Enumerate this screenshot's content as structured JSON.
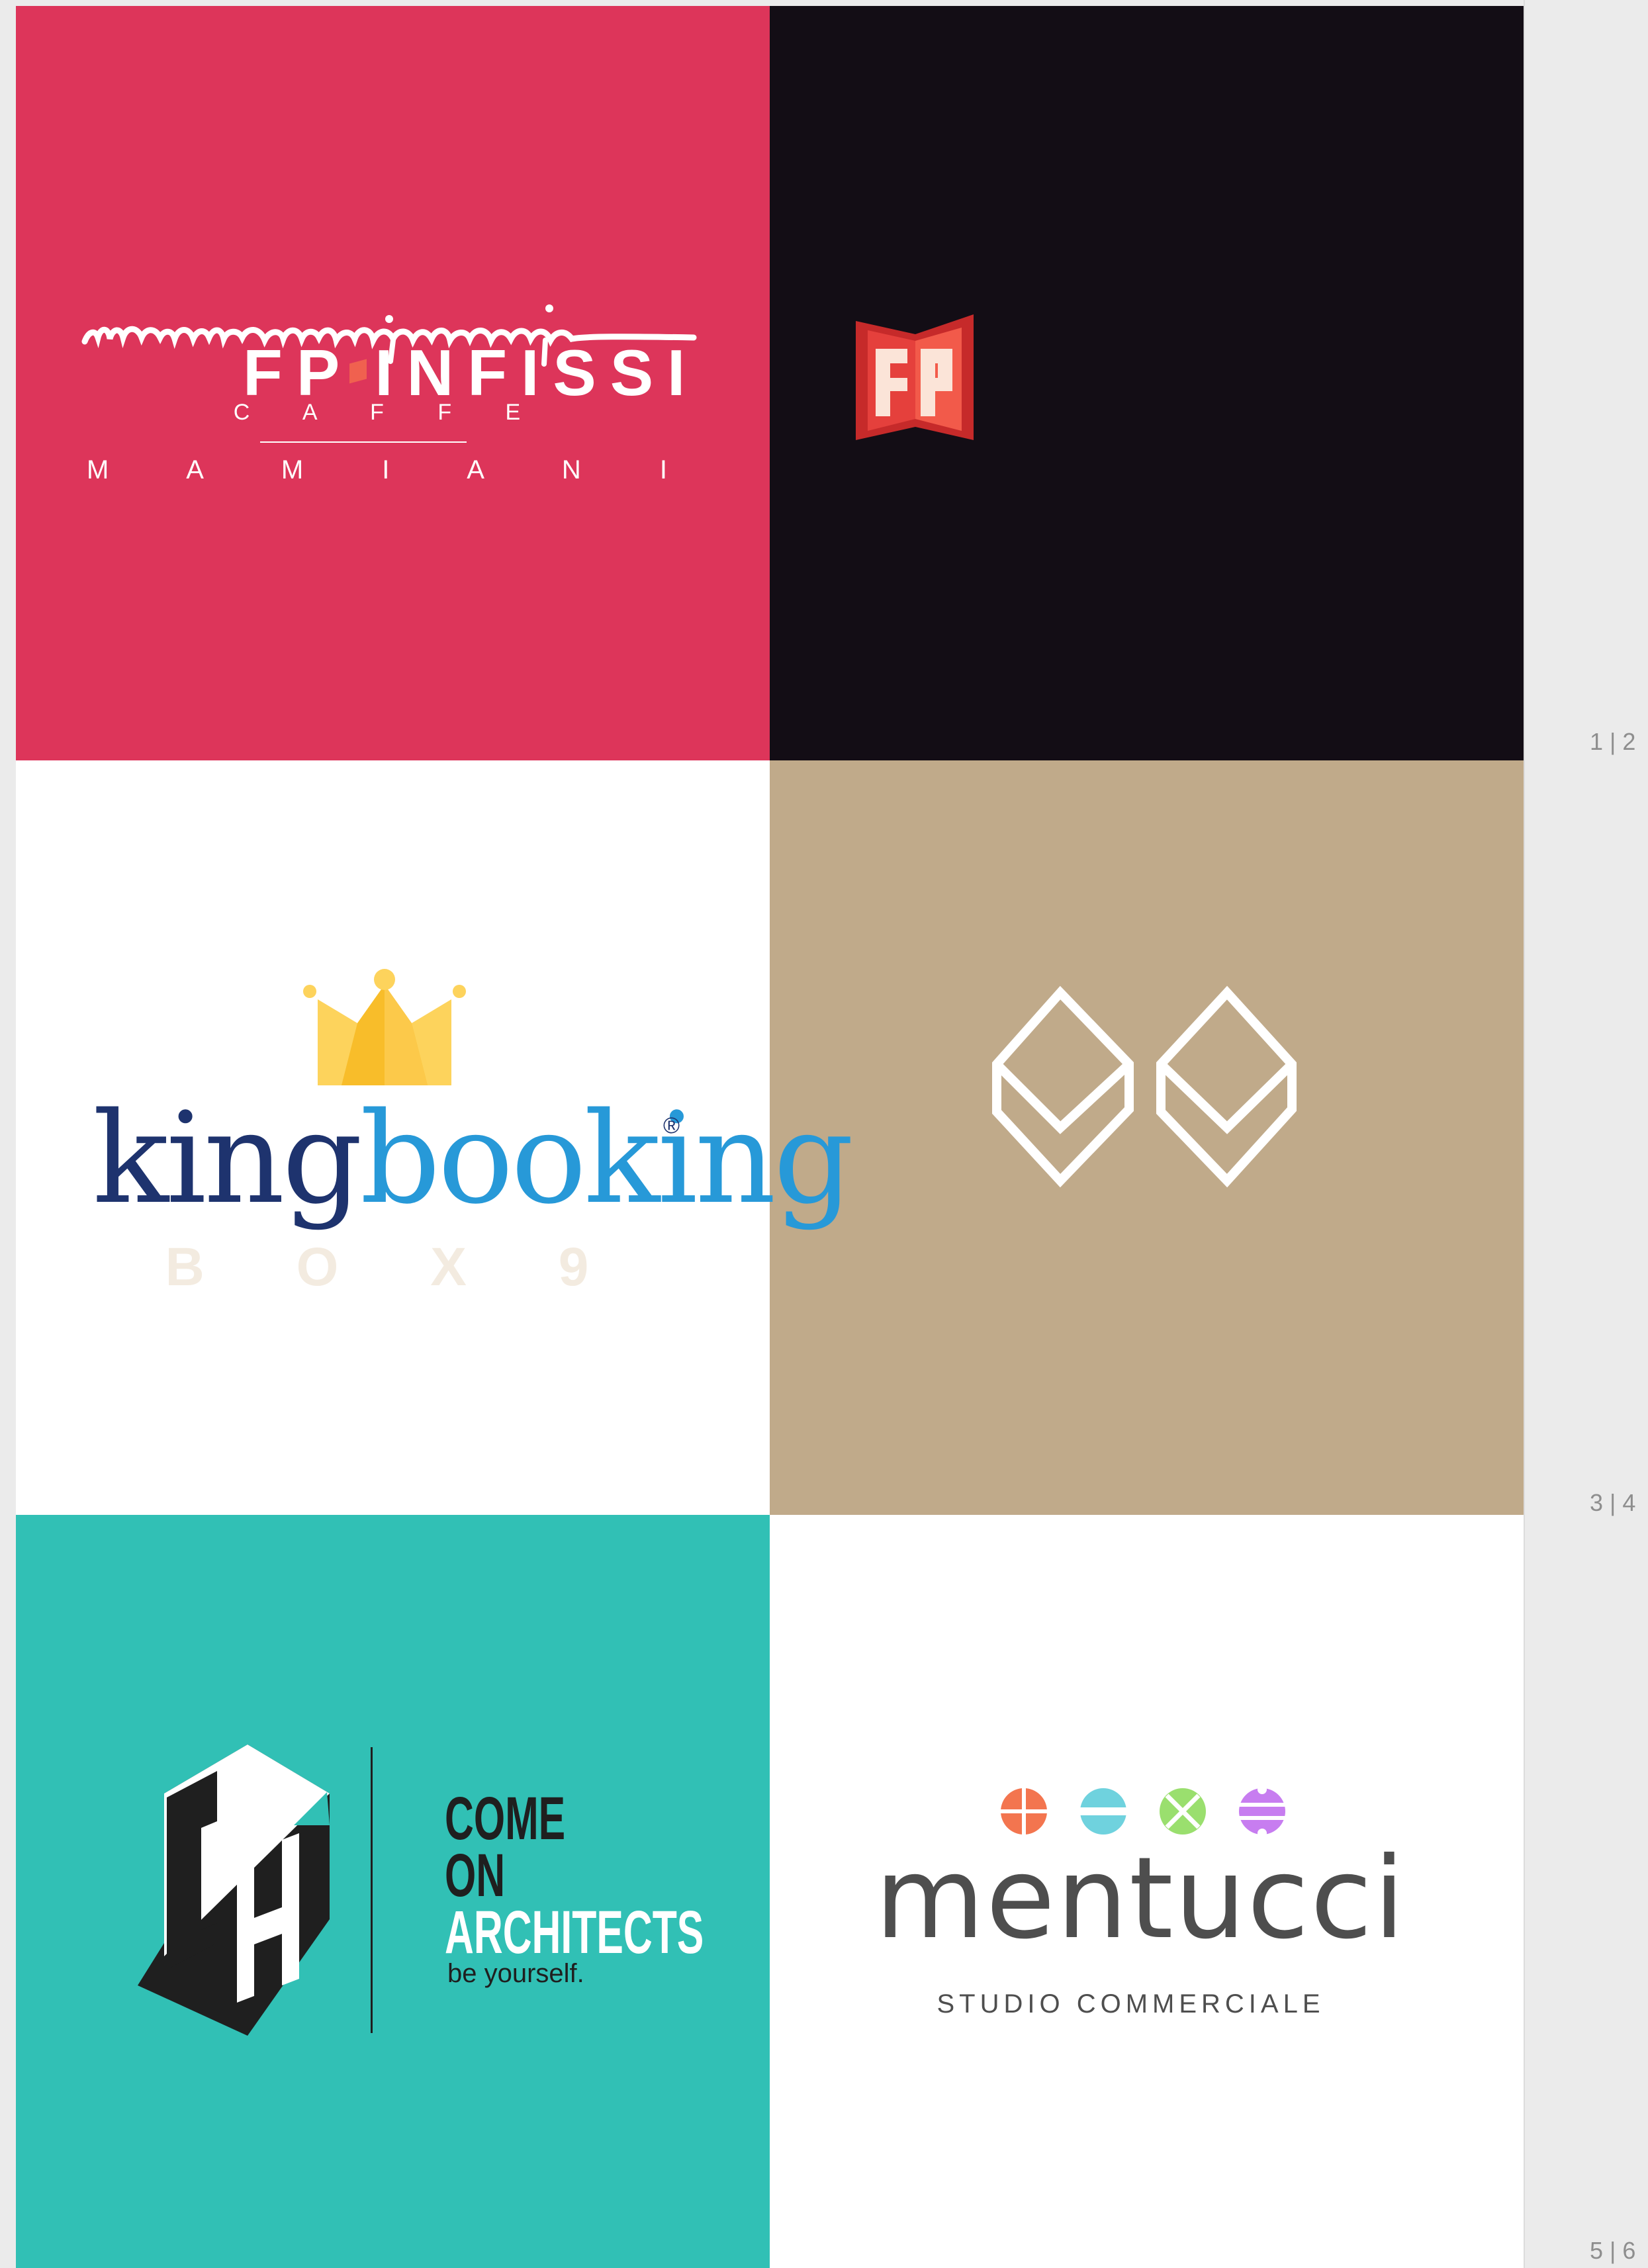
{
  "tiles": [
    {
      "logo": "mamiani",
      "background": "#dd355a",
      "line1": "C A F F E",
      "line2": "M A M I A N I",
      "script_wordmark": "mamiani"
    },
    {
      "logo": "fp-infissi",
      "background": "#130d15",
      "wordmark_left": "FP",
      "wordmark_right": "INFISSI",
      "accent": "#f0614f"
    },
    {
      "logo": "kingbooking",
      "background": "#ffffff",
      "part1": "king",
      "part2": "booking",
      "registered": "®",
      "crown_color": "#fbc02d"
    },
    {
      "logo": "box9",
      "background": "#c0aa8a",
      "wordmark": "B O X 9"
    },
    {
      "logo": "come-on-architects",
      "background": "#31c0b5",
      "line1": "COME",
      "line2": "ON",
      "line3": "ARCHITECTS",
      "tagline": "be yourself."
    },
    {
      "logo": "mentucci",
      "background": "#ffffff",
      "wordmark": "mentucci",
      "subtitle": "STUDIO COMMERCIALE",
      "dot_colors": [
        "#f3754f",
        "#6fd2de",
        "#9adf6e",
        "#c77df0"
      ]
    }
  ],
  "page_numbers": [
    "1 | 2",
    "3 | 4",
    "5 | 6"
  ]
}
